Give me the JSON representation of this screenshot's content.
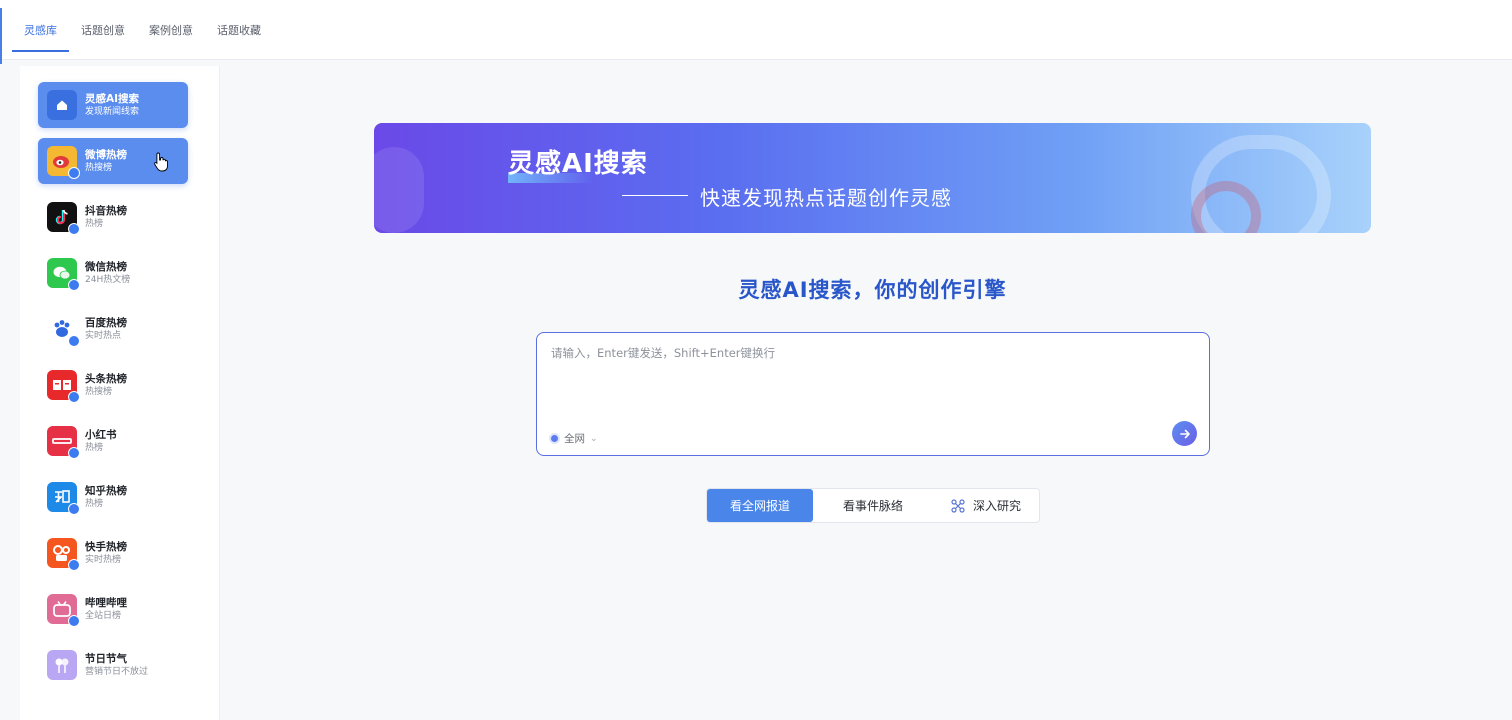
{
  "tabs": [
    {
      "label": "灵感库",
      "active": true
    },
    {
      "label": "话题创意",
      "active": false
    },
    {
      "label": "案例创意",
      "active": false
    },
    {
      "label": "话题收藏",
      "active": false
    }
  ],
  "sidebar": {
    "items": [
      {
        "title": "灵感AI搜索",
        "sub": "发现新闻线索",
        "icon": "home-icon",
        "color": "#3a6fe0",
        "selected": true
      },
      {
        "title": "微博热榜",
        "sub": "热搜榜",
        "icon": "weibo-icon",
        "color": "#f5b833",
        "selected": true
      },
      {
        "title": "抖音热榜",
        "sub": "热榜",
        "icon": "douyin-icon",
        "color": "#111111",
        "selected": false
      },
      {
        "title": "微信热榜",
        "sub": "24H热文榜",
        "icon": "wechat-icon",
        "color": "#2dc84d",
        "selected": false
      },
      {
        "title": "百度热榜",
        "sub": "实时热点",
        "icon": "baidu-icon",
        "color": "#ffffff",
        "selected": false
      },
      {
        "title": "头条热榜",
        "sub": "热搜榜",
        "icon": "toutiao-icon",
        "color": "#e8292b",
        "selected": false
      },
      {
        "title": "小红书",
        "sub": "热榜",
        "icon": "xiaohongshu-icon",
        "color": "#e63045",
        "selected": false
      },
      {
        "title": "知乎热榜",
        "sub": "热榜",
        "icon": "zhihu-icon",
        "color": "#1e8ae8",
        "selected": false
      },
      {
        "title": "快手热榜",
        "sub": "实时热榜",
        "icon": "kuaishou-icon",
        "color": "#f5561f",
        "selected": false
      },
      {
        "title": "哔哩哔哩",
        "sub": "全站日榜",
        "icon": "bilibili-icon",
        "color": "#e06b94",
        "selected": false
      },
      {
        "title": "节日节气",
        "sub": "营销节日不放过",
        "icon": "festival-icon",
        "color": "#b9a7f3",
        "selected": false
      }
    ]
  },
  "banner": {
    "title": "灵感AI搜索",
    "subtitle": "快速发现热点话题创作灵感"
  },
  "headline": "灵感AI搜索，你的创作引擎",
  "search": {
    "placeholder": "请输入，Enter键发送，Shift+Enter键换行",
    "value": "",
    "scope": "全网"
  },
  "modes": [
    {
      "label": "看全网报道",
      "active": true
    },
    {
      "label": "看事件脉络",
      "active": false
    },
    {
      "label": "深入研究",
      "active": false
    }
  ],
  "colors": {
    "accent": "#3b6fe0",
    "headline": "#2957c9",
    "mode_active": "#4a86ea"
  }
}
